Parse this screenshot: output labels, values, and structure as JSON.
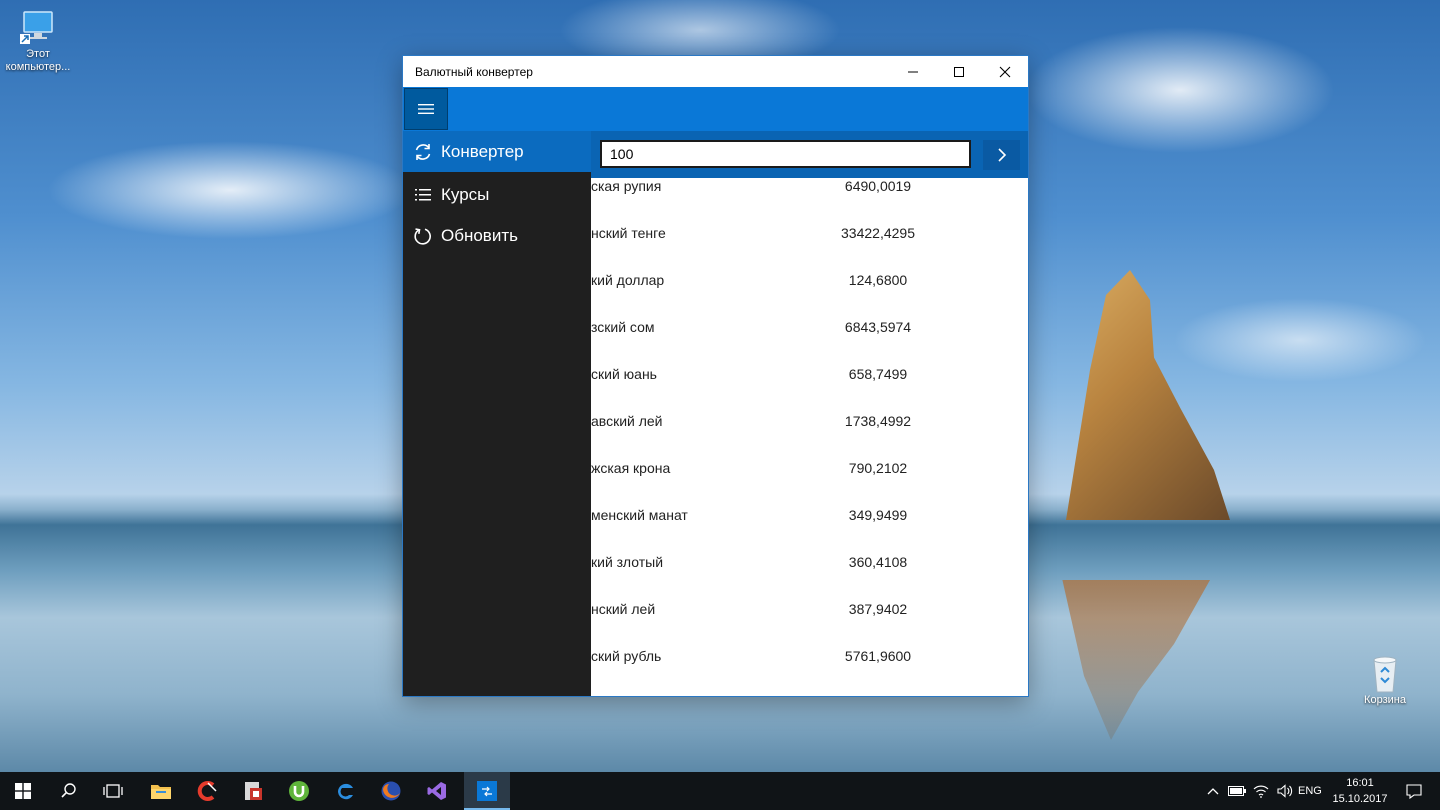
{
  "desktop": {
    "icons": [
      {
        "label": "Этот компьютер..."
      },
      {
        "label": "Корзина"
      }
    ]
  },
  "window": {
    "title": "Валютный конвертер",
    "minimize_glyph": "—",
    "maximize_glyph": "☐",
    "close_glyph": "✕"
  },
  "converter": {
    "amount_value": "100"
  },
  "nav": {
    "items": [
      {
        "label": "Конвертер",
        "icon": "sync-icon",
        "selected": true
      },
      {
        "label": "Курсы",
        "icon": "list-icon",
        "selected": false
      },
      {
        "label": "Обновить",
        "icon": "refresh-icon",
        "selected": false
      }
    ]
  },
  "rates": [
    {
      "name": "ская рупия",
      "value": "6490,0019"
    },
    {
      "name": "нский тенге",
      "value": "33422,4295"
    },
    {
      "name": "кий доллар",
      "value": "124,6800"
    },
    {
      "name": "зский сом",
      "value": "6843,5974"
    },
    {
      "name": "ский юань",
      "value": "658,7499"
    },
    {
      "name": "авский лей",
      "value": "1738,4992"
    },
    {
      "name": "жская крона",
      "value": "790,2102"
    },
    {
      "name": "менский манат",
      "value": "349,9499"
    },
    {
      "name": "кий злотый",
      "value": "360,4108"
    },
    {
      "name": "нский лей",
      "value": "387,9402"
    },
    {
      "name": "ский рубль",
      "value": "5761,9600"
    }
  ],
  "taskbar": {
    "language": "ENG",
    "time": "16:01",
    "date": "15.10.2017"
  }
}
